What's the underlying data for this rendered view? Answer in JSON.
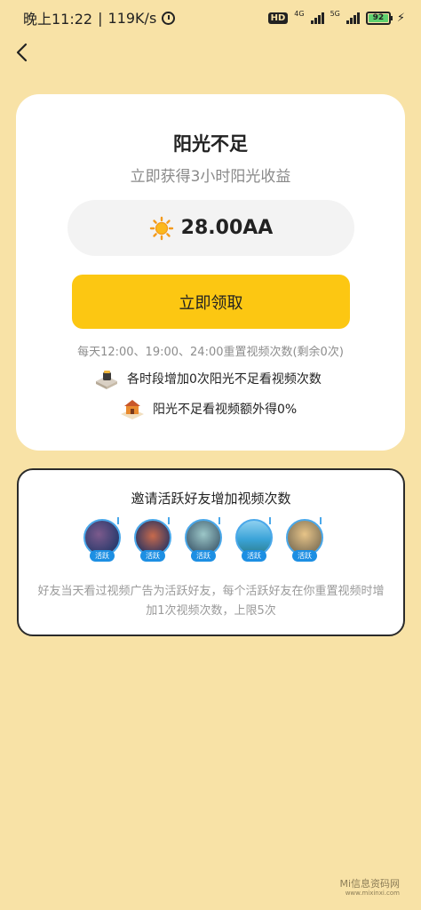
{
  "status_bar": {
    "time": "晚上11:22",
    "speed": "119K/s",
    "hd_label": "HD",
    "network_1": "4G",
    "network_2": "5G",
    "battery": "92",
    "battery_level": 0.92
  },
  "back_icon": "chevron-left",
  "main_card": {
    "title": "阳光不足",
    "subtitle": "立即获得3小时阳光收益",
    "amount": "28.00AA",
    "claim_label": "立即领取",
    "reset_note": "每天12:00、19:00、24:00重置视频次数(剩余0次)",
    "row_1": "各时段增加0次阳光不足看视频次数",
    "row_2": "阳光不足看视频额外得0%"
  },
  "invite_card": {
    "title": "邀请活跃好友增加视频次数",
    "badge_label": "活跃",
    "avatars": [
      {
        "badge": "活跃"
      },
      {
        "badge": "活跃"
      },
      {
        "badge": "活跃"
      },
      {
        "badge": "活跃"
      },
      {
        "badge": "活跃"
      }
    ],
    "description": "好友当天看过视频广告为活跃好友，每个活跃好友在你重置视频时增加1次视频次数，上限5次"
  },
  "watermark": {
    "text": "Mi信息资码网",
    "url": "www.mixinxi.com"
  },
  "colors": {
    "background": "#f8e2a6",
    "accent": "#fcc712",
    "badge": "#1d8fe3"
  }
}
